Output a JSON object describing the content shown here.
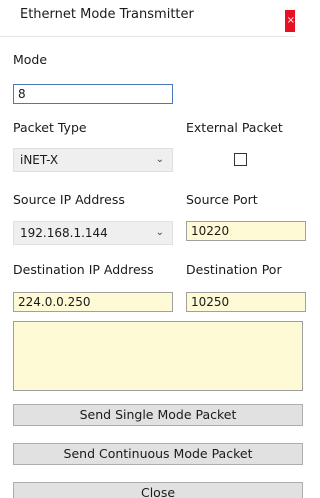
{
  "window": {
    "title": "Ethernet Mode Transmitter",
    "close_glyph": "×"
  },
  "mode": {
    "label": "Mode",
    "value": "8"
  },
  "packet_type": {
    "label": "Packet Type",
    "selected": "iNET-X",
    "chevron": "⌄"
  },
  "external_packet": {
    "label": "External Packet",
    "checked": false
  },
  "source_ip": {
    "label": "Source IP Address",
    "selected": "192.168.1.144",
    "chevron": "⌄"
  },
  "source_port": {
    "label": "Source Port",
    "value": "10220"
  },
  "destination_ip": {
    "label": "Destination IP Address",
    "value": "224.0.0.250"
  },
  "destination_port": {
    "label": "Destination Por",
    "value": "10250"
  },
  "buttons": {
    "send_single": "Send Single Mode Packet",
    "send_continuous": "Send Continuous Mode Packet",
    "close": "Close"
  },
  "colors": {
    "field_yellow": "#fffad6",
    "close_red": "#e81123",
    "button_gray": "#e1e1e1"
  }
}
